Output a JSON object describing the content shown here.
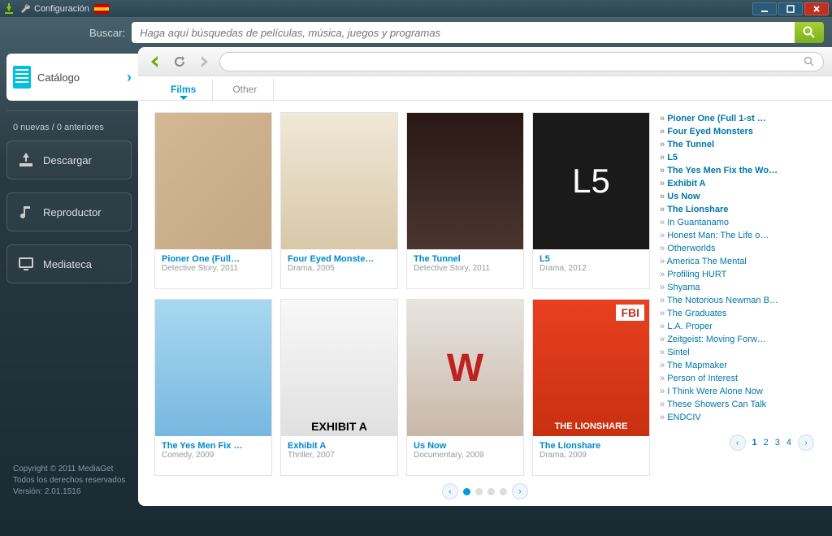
{
  "titlebar": {
    "config": "Configuración"
  },
  "search": {
    "label": "Buscar:",
    "placeholder": "Haga aquí búsquedas de películas, música, juegos y programas"
  },
  "sidebar": {
    "catalog": "Catálogo",
    "status": "0 nuevas / 0 anteriores",
    "download": "Descargar",
    "player": "Reproductor",
    "library": "Mediateca"
  },
  "footer": {
    "l1": "Copyright © 2011 MediaGet",
    "l2": "Todos los derechos reservados",
    "l3": "Versión: 2.01.1516"
  },
  "tabs": {
    "films": "Films",
    "other": "Other"
  },
  "cards": [
    {
      "title": "Pioner One (Full…",
      "meta": "Detective Story, 2011"
    },
    {
      "title": "Four Eyed Monste…",
      "meta": "Drama, 2005"
    },
    {
      "title": "The Tunnel",
      "meta": "Detective Story, 2011"
    },
    {
      "title": "L5",
      "meta": "Drama, 2012"
    },
    {
      "title": "The Yes Men Fix …",
      "meta": "Comedy, 2009"
    },
    {
      "title": "Exhibit A",
      "meta": "Thriller, 2007"
    },
    {
      "title": "Us Now",
      "meta": "Documentary, 2009"
    },
    {
      "title": "The Lionshare",
      "meta": "Drama, 2009"
    }
  ],
  "poster_text": {
    "l5": "L5",
    "exhibit": "EXHIBIT A",
    "usnow_w": "W",
    "fbi": "FBI",
    "lionshare": "THE LIONSHARE"
  },
  "rightlist": [
    {
      "t": "Pioner One (Full 1-st …",
      "b": true
    },
    {
      "t": "Four Eyed Monsters",
      "b": true
    },
    {
      "t": "The Tunnel",
      "b": true
    },
    {
      "t": "L5",
      "b": true
    },
    {
      "t": "The Yes Men Fix the Wo…",
      "b": true
    },
    {
      "t": "Exhibit A",
      "b": true
    },
    {
      "t": "Us Now",
      "b": true
    },
    {
      "t": "The Lionshare",
      "b": true
    },
    {
      "t": "In Guantanamo",
      "b": false
    },
    {
      "t": "Honest Man: The Life o…",
      "b": false
    },
    {
      "t": "Otherworlds",
      "b": false
    },
    {
      "t": "America The Mental",
      "b": false
    },
    {
      "t": "Profiling HURT",
      "b": false
    },
    {
      "t": "Shyama",
      "b": false
    },
    {
      "t": "The Notorious Newman B…",
      "b": false
    },
    {
      "t": "The Graduates",
      "b": false
    },
    {
      "t": "L.A. Proper",
      "b": false
    },
    {
      "t": "Zeitgeist: Moving Forw…",
      "b": false
    },
    {
      "t": "Sintel",
      "b": false
    },
    {
      "t": "The Mapmaker",
      "b": false
    },
    {
      "t": "Person of Interest",
      "b": false
    },
    {
      "t": "I Think Were Alone Now",
      "b": false
    },
    {
      "t": "These Showers Can Talk",
      "b": false
    },
    {
      "t": "ENDCIV",
      "b": false
    }
  ],
  "pagerNums": [
    "1",
    "2",
    "3",
    "4"
  ]
}
